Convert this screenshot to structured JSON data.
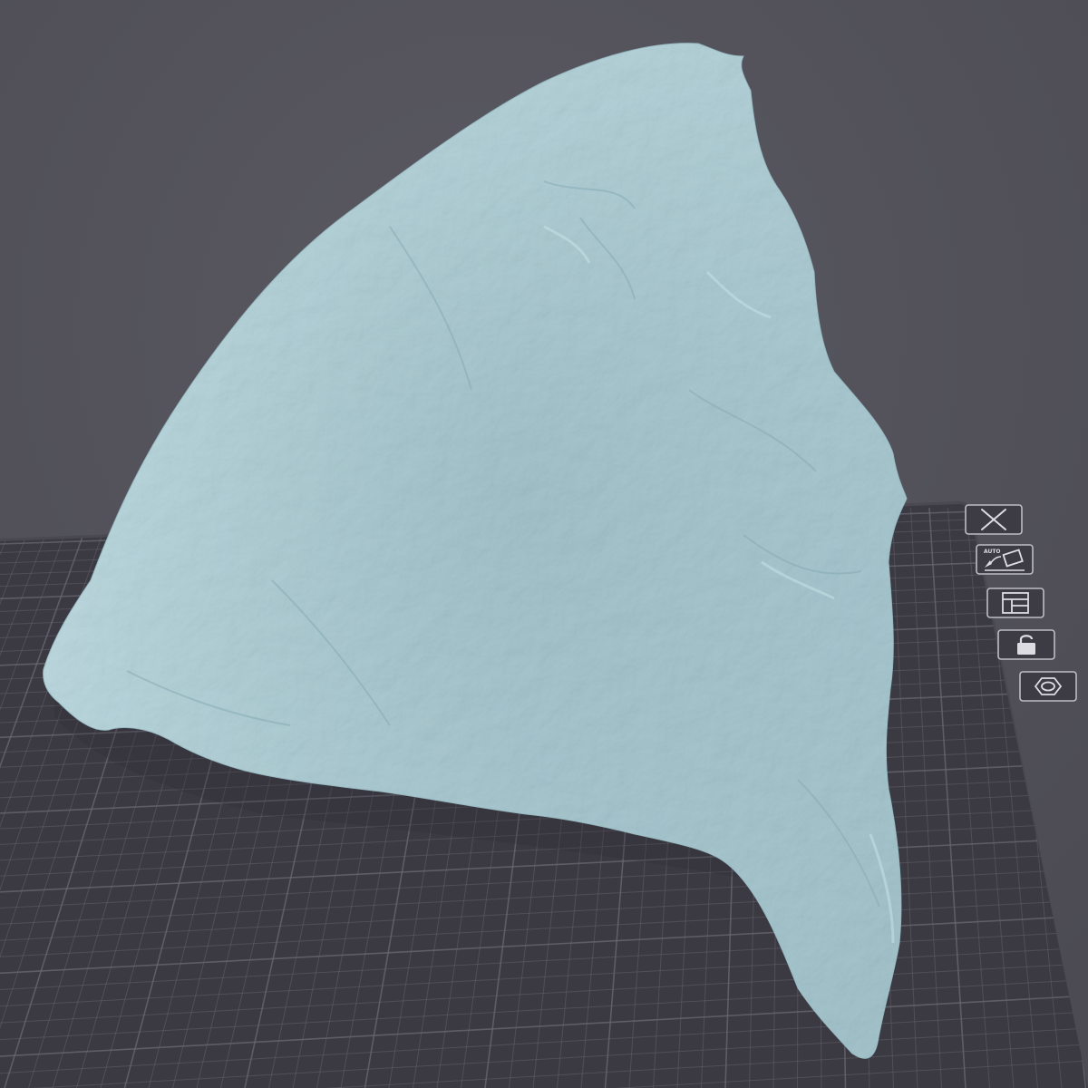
{
  "viewport": {
    "background_color": "#54535b",
    "bed_color": "#3b3a42",
    "bed_edge_color": "#4a4951",
    "grid_line_color": "#6a6972",
    "model_color": "#a3c6cf"
  },
  "model": {
    "name": ""
  },
  "bed_toolbar": {
    "buttons": [
      {
        "id": "delete",
        "icon": "close-icon"
      },
      {
        "id": "auto-arrange",
        "icon": "auto-orient-icon",
        "text": "AUTO"
      },
      {
        "id": "arrange",
        "icon": "arrange-layout-icon"
      },
      {
        "id": "lock",
        "icon": "lock-icon"
      },
      {
        "id": "settings",
        "icon": "hex-settings-icon"
      }
    ]
  }
}
